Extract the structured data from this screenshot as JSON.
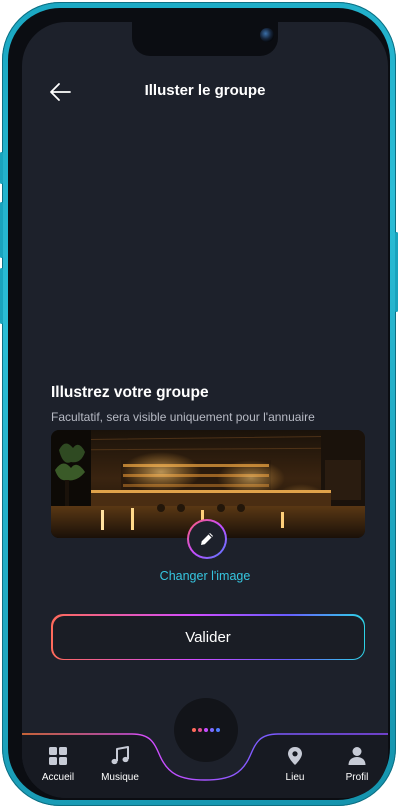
{
  "header": {
    "title": "Illuster le groupe",
    "back_icon": "arrow-left-icon"
  },
  "section": {
    "title": "Illustrez votre groupe",
    "subtitle": "Facultatif, sera visible uniquement pour l'annuaire"
  },
  "image": {
    "edit_icon": "pencil-icon",
    "change_label": "Changer l'image"
  },
  "actions": {
    "validate_label": "Valider"
  },
  "tabbar": {
    "items": [
      {
        "label": "Accueil",
        "icon": "grid-icon"
      },
      {
        "label": "Musique",
        "icon": "music-note-icon"
      },
      {
        "label": "Lieu",
        "icon": "map-pin-icon"
      },
      {
        "label": "Profil",
        "icon": "user-icon"
      }
    ],
    "center_icon": "dots-menu-icon"
  },
  "colors": {
    "background": "#1d212b",
    "accent": "#36c6e0",
    "gradient": [
      "#ff6a5a",
      "#d24cff",
      "#6a5cff",
      "#2ed3e6"
    ]
  }
}
